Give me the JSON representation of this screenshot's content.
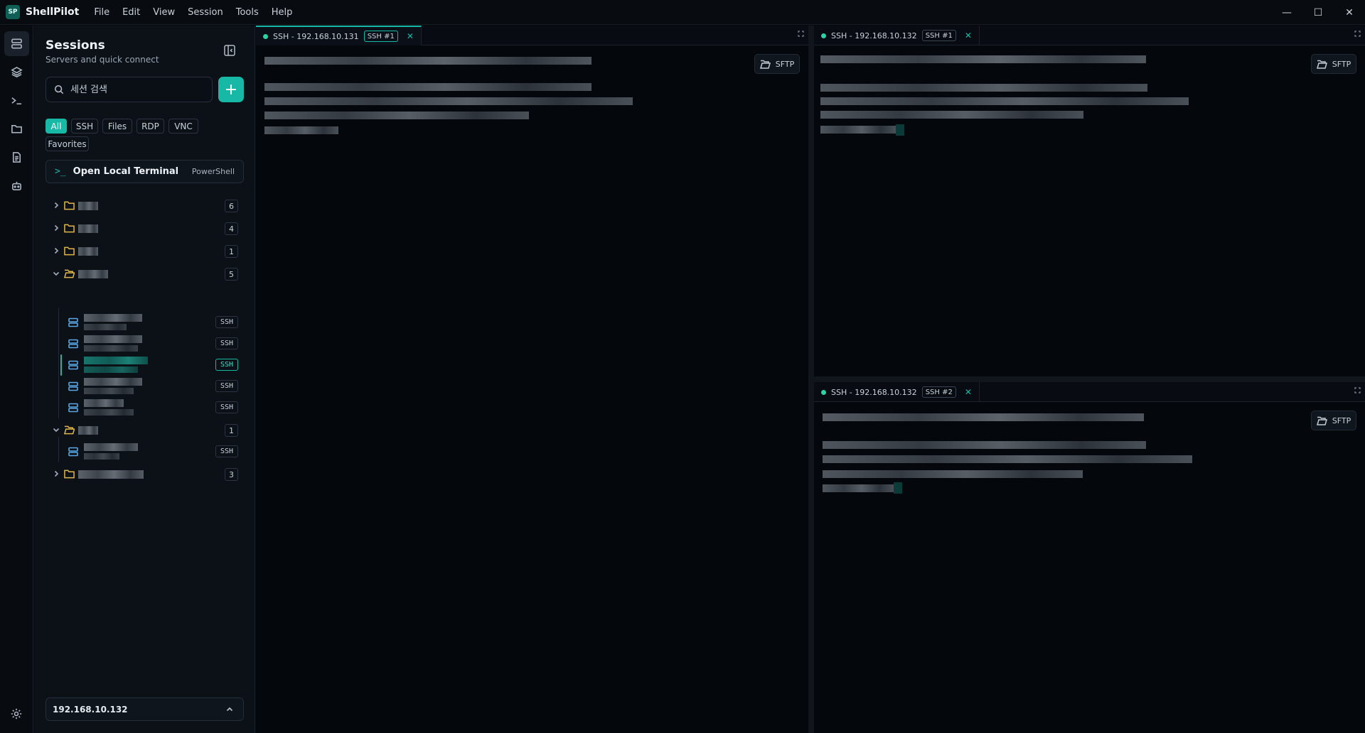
{
  "app": {
    "logo_text": "SP",
    "title": "ShellPilot",
    "menu": [
      "File",
      "Edit",
      "View",
      "Session",
      "Tools",
      "Help"
    ],
    "window_controls": {
      "minimize": "—",
      "maximize": "☐",
      "close": "✕"
    }
  },
  "rail": {
    "icons": [
      "sessions-icon",
      "layers-icon",
      "terminal-icon",
      "folder-icon",
      "document-icon",
      "bot-icon"
    ],
    "settings_icon": "gear-icon"
  },
  "sidebar": {
    "title": "Sessions",
    "subtitle": "Servers and quick connect",
    "search_placeholder": "세션 검색",
    "add_label": "+",
    "filters": [
      "All",
      "SSH",
      "Files",
      "RDP",
      "VNC",
      "Favorites"
    ],
    "active_filter": "All",
    "local_terminal": {
      "prompt": ">_",
      "label": "Open Local Terminal",
      "shell": "PowerShell"
    },
    "folders": [
      {
        "count": "6",
        "expanded": false
      },
      {
        "count": "4",
        "expanded": false
      },
      {
        "count": "1",
        "expanded": false
      },
      {
        "count": "5",
        "expanded": true,
        "servers": [
          "SSH",
          "SSH",
          "SSH",
          "SSH",
          "SSH"
        ]
      },
      {
        "count": "1",
        "expanded": true,
        "servers": [
          "SSH"
        ]
      },
      {
        "count": "3",
        "expanded": false
      }
    ],
    "active_host": "192.168.10.132"
  },
  "panes": [
    {
      "tab_label": "SSH - 192.168.10.131",
      "session_tag": "SSH #1",
      "close": "✕",
      "sftp_label": "SFTP",
      "active": true
    },
    {
      "tab_label": "SSH - 192.168.10.132",
      "session_tag": "SSH #1",
      "close": "✕",
      "sftp_label": "SFTP",
      "active": false
    },
    {
      "tab_label": "SSH - 192.168.10.132",
      "session_tag": "SSH #2",
      "close": "✕",
      "sftp_label": "SFTP",
      "active": false
    }
  ],
  "colors": {
    "accent": "#17b8a6",
    "folder": "#e0b64b",
    "server_icon": "#5aa7e6",
    "status_dot": "#2bd4a4"
  }
}
